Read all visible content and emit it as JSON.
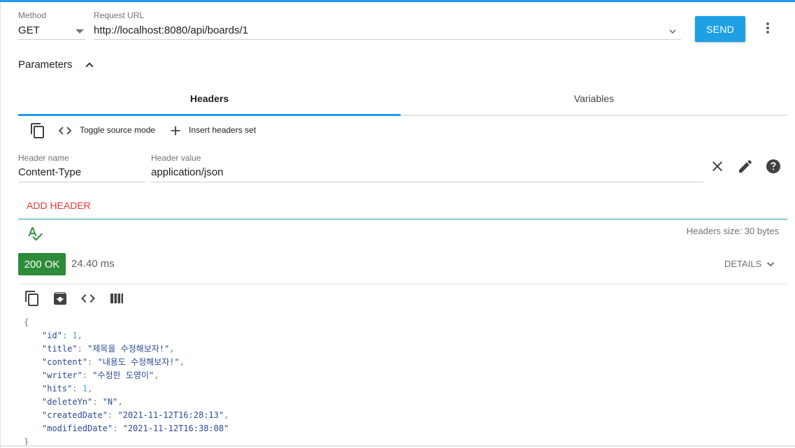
{
  "request": {
    "method_label": "Method",
    "method_value": "GET",
    "url_label": "Request URL",
    "url_value": "http://localhost:8080/api/boards/1",
    "send_label": "SEND"
  },
  "parameters": {
    "label": "Parameters"
  },
  "tabs": [
    {
      "label": "Headers",
      "active": true
    },
    {
      "label": "Variables",
      "active": false
    }
  ],
  "headers_toolbar": {
    "toggle_source_label": "Toggle source mode",
    "insert_headers_label": "Insert headers set"
  },
  "header_row": {
    "name_label": "Header name",
    "name_value": "Content-Type",
    "value_label": "Header value",
    "value_value": "application/json"
  },
  "add_header_label": "ADD HEADER",
  "headers_size": "Headers size: 30 bytes",
  "response": {
    "status": "200 OK",
    "time": "24.40 ms",
    "details_label": "DETAILS"
  },
  "json_body": {
    "open_brace": "{",
    "close_brace": "}",
    "fields": [
      {
        "key": "\"id\"",
        "value": "1",
        "type": "number"
      },
      {
        "key": "\"title\"",
        "value": "\"제목을 수정해보자!\"",
        "type": "string"
      },
      {
        "key": "\"content\"",
        "value": "\"내용도 수정해보자!\"",
        "type": "string"
      },
      {
        "key": "\"writer\"",
        "value": "\"수정한 도영이\"",
        "type": "string"
      },
      {
        "key": "\"hits\"",
        "value": "1",
        "type": "number"
      },
      {
        "key": "\"deleteYn\"",
        "value": "\"N\"",
        "type": "string"
      },
      {
        "key": "\"createdDate\"",
        "value": "\"2021-11-12T16:28:13\"",
        "type": "string"
      },
      {
        "key": "\"modifiedDate\"",
        "value": "\"2021-11-12T16:38:08\"",
        "type": "string"
      }
    ]
  },
  "colors": {
    "accent": "#1ea0e4",
    "status_ok": "#2e8b3a",
    "add_header": "#e53935",
    "tab_indicator": "#1e9ce8"
  },
  "icons": [
    "more-vert-icon",
    "chevron-up-icon",
    "chevron-down-icon",
    "copy-icon",
    "code-icon",
    "plus-icon",
    "close-icon",
    "edit-icon",
    "help-icon",
    "spellcheck-icon",
    "archive-icon",
    "columns-icon"
  ]
}
